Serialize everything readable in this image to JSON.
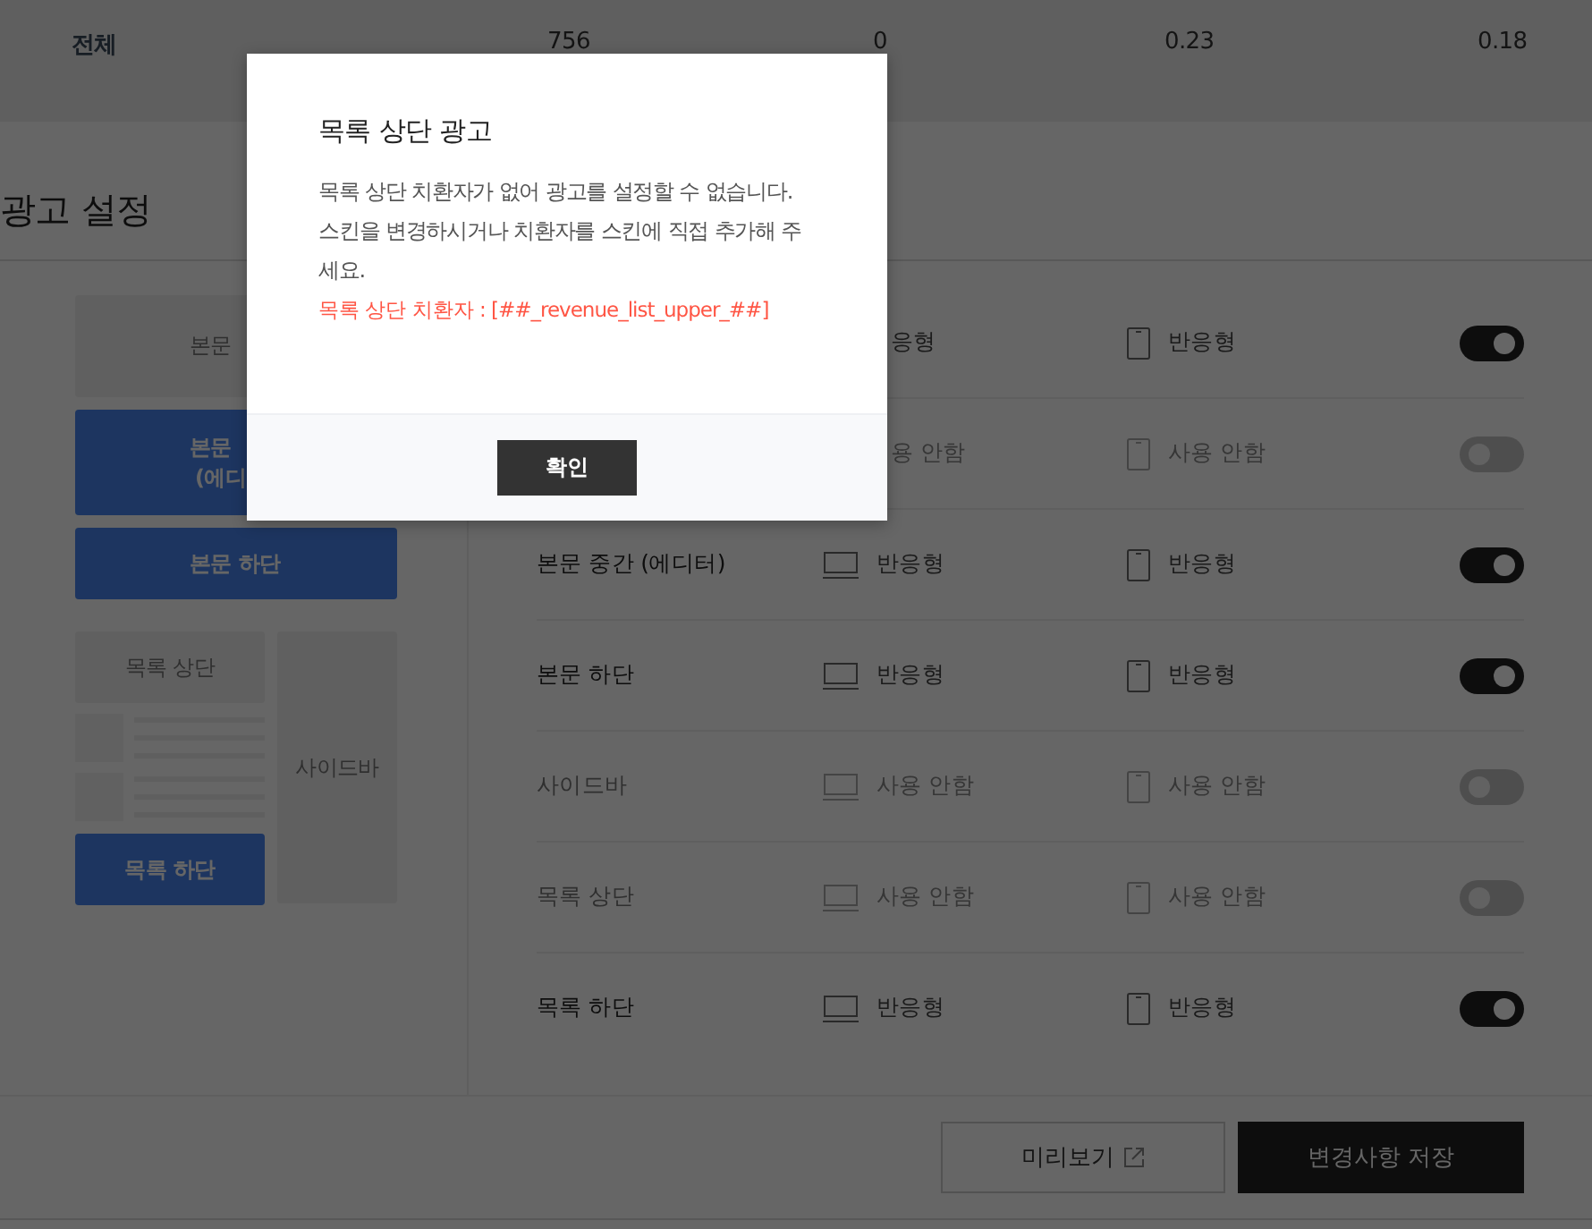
{
  "summary_row": {
    "label": "전체",
    "values": [
      "756",
      "0",
      "0.23",
      "0.18"
    ]
  },
  "section_title": "광고 설정",
  "preview": {
    "blocks": [
      {
        "lines": [
          "본문"
        ],
        "active": false
      },
      {
        "lines": [
          "본문",
          "(에디"
        ],
        "active": true
      },
      {
        "lines": [
          "본문 하단"
        ],
        "active": true
      }
    ],
    "list_top": {
      "label": "목록 상단",
      "active": false
    },
    "sidebar": {
      "label": "사이드바",
      "active": false
    },
    "list_bottom": {
      "label": "목록 하단",
      "active": true
    }
  },
  "rows": [
    {
      "pc": {
        "text": "응형",
        "icon": false
      },
      "mobile": {
        "text": "반응형"
      },
      "on": true
    },
    {
      "pc": {
        "text": "용 안함",
        "icon": false
      },
      "mobile": {
        "text": "사용 안함"
      },
      "on": false
    },
    {
      "label": "본문 중간 (에디터)",
      "pc": {
        "text": "반응형",
        "icon": true
      },
      "mobile": {
        "text": "반응형"
      },
      "on": true
    },
    {
      "label": "본문 하단",
      "pc": {
        "text": "반응형",
        "icon": true
      },
      "mobile": {
        "text": "반응형"
      },
      "on": true
    },
    {
      "label": "사이드바",
      "pc": {
        "text": "사용 안함",
        "icon": true
      },
      "mobile": {
        "text": "사용 안함"
      },
      "on": false
    },
    {
      "label": "목록 상단",
      "pc": {
        "text": "사용 안함",
        "icon": true
      },
      "mobile": {
        "text": "사용 안함"
      },
      "on": false
    },
    {
      "label": "목록 하단",
      "pc": {
        "text": "반응형",
        "icon": true
      },
      "mobile": {
        "text": "반응형"
      },
      "on": true
    }
  ],
  "footer": {
    "preview_button": "미리보기",
    "save_button": "변경사항 저장"
  },
  "modal": {
    "title": "목록 상단 광고",
    "message": "목록 상단 치환자가 없어 광고를 설정할 수 없습니다. 스킨을 변경하시거나 치환자를 스킨에 직접 추가해 주세요.",
    "code_note": "목록 상단 치환자 : [##_revenue_list_upper_##]",
    "confirm": "확인"
  }
}
